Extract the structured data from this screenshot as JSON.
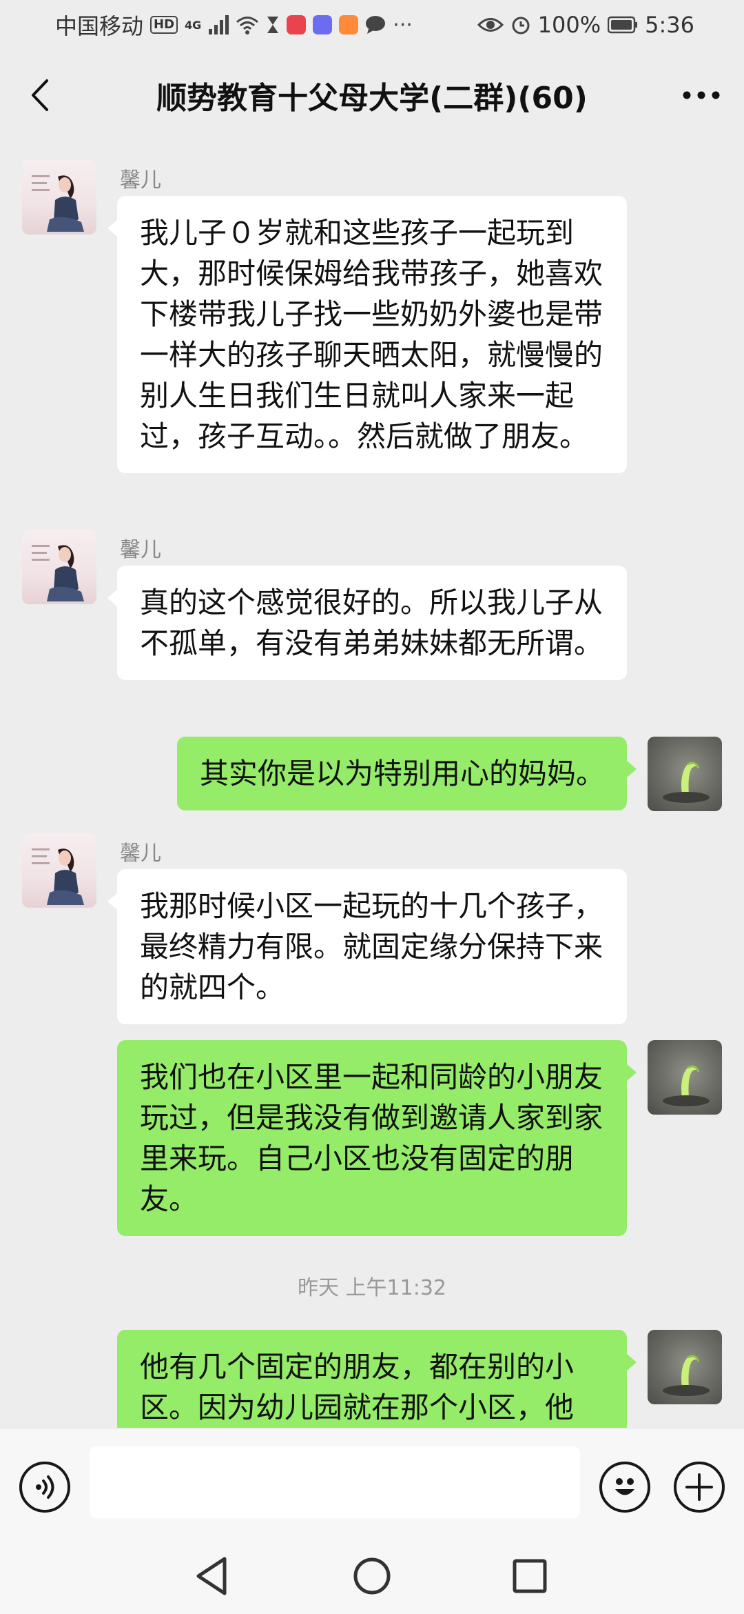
{
  "status_bar": {
    "carrier": "中国移动",
    "hd": "HD",
    "network": "4G",
    "battery": "100%",
    "time": "5:36",
    "more": "···",
    "app_colors": [
      "#e8434e",
      "#6c6cf0",
      "#ff8a3a"
    ]
  },
  "header": {
    "title": "顺势教育十父母大学(二群)(60)"
  },
  "messages": [
    {
      "direction": "in",
      "sender": "馨儿",
      "text": "我儿子０岁就和这些孩子一起玩到大，那时候保姆给我带孩子，她喜欢下楼带我儿子找一些奶奶外婆也是带一样大的孩子聊天晒太阳，就慢慢的别人生日我们生日就叫人家来一起过，孩子互动。。然后就做了朋友。"
    },
    {
      "direction": "in",
      "sender": "馨儿",
      "text": "真的这个感觉很好的。所以我儿子从不孤单，有没有弟弟妹妹都无所谓。"
    },
    {
      "direction": "out",
      "text": "其实你是以为特别用心的妈妈。"
    },
    {
      "direction": "in",
      "sender": "馨儿",
      "text": "我那时候小区一起玩的十几个孩子，最终精力有限。就固定缘分保持下来的就四个。"
    },
    {
      "direction": "out",
      "text": "我们也在小区里一起和同龄的小朋友玩过，但是我没有做到邀请人家到家里来玩。自己小区也没有固定的朋友。"
    },
    {
      "timestamp": "昨天 上午11:32"
    },
    {
      "direction": "out",
      "text": "他有几个固定的朋友，都在别的小区。因为幼儿园就在那个小区，他"
    }
  ],
  "input": {
    "value": "",
    "placeholder": ""
  },
  "icons": {
    "back": "chevron-left-icon",
    "more": "more-dots-icon",
    "voice": "voice-icon",
    "emoji": "emoji-icon",
    "plus": "plus-icon",
    "nav_back": "triangle-back-icon",
    "nav_home": "circle-home-icon",
    "nav_recent": "square-recent-icon"
  },
  "colors": {
    "background": "#ededed",
    "incoming_bubble": "#ffffff",
    "outgoing_bubble": "#95ec69",
    "sender_name": "#888888",
    "timestamp": "#999999"
  }
}
